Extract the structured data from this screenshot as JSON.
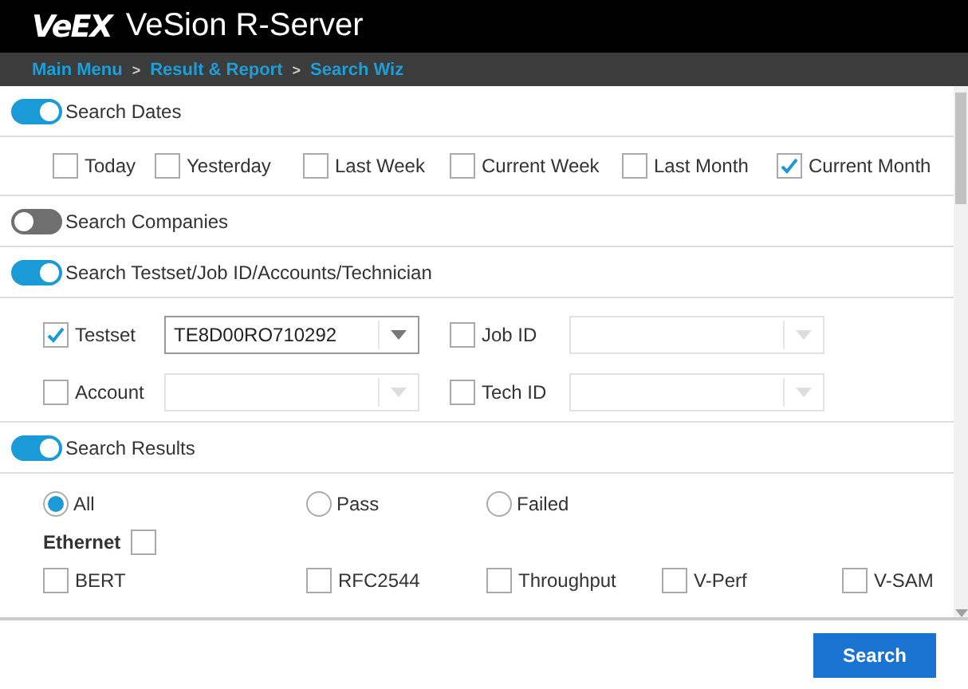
{
  "header": {
    "brand": "VeEX",
    "title": "VeSion R-Server"
  },
  "breadcrumb": [
    {
      "kind": "link",
      "text": "Main Menu"
    },
    {
      "kind": "sep",
      "text": ">"
    },
    {
      "kind": "link",
      "text": "Result & Report"
    },
    {
      "kind": "sep",
      "text": ">"
    },
    {
      "kind": "link",
      "text": "Search Wiz"
    }
  ],
  "sections": [
    {
      "kind": "dates",
      "label": "Search Dates",
      "on": true,
      "options": [
        {
          "label": "Today",
          "checked": false
        },
        {
          "label": "Yesterday",
          "checked": false
        },
        {
          "label": "Last Week",
          "checked": false
        },
        {
          "label": "Current Week",
          "checked": false
        },
        {
          "label": "Last Month",
          "checked": false
        },
        {
          "label": "Current Month",
          "checked": true
        }
      ]
    },
    {
      "kind": "plain",
      "label": "Search Companies",
      "on": false
    },
    {
      "kind": "fields",
      "label": "Search Testset/Job ID/Accounts/Technician",
      "on": true,
      "fields": [
        {
          "label": "Testset",
          "checked": true,
          "value": "TE8D00RO710292",
          "disabled": false
        },
        {
          "label": "Job ID",
          "checked": false,
          "disabled": true
        },
        {
          "label": "Account",
          "checked": false,
          "disabled": true
        },
        {
          "label": "Tech ID",
          "checked": false,
          "disabled": true
        }
      ]
    },
    {
      "kind": "results",
      "label": "Search Results",
      "on": true,
      "outcomes": [
        {
          "label": "All",
          "selected": true
        },
        {
          "label": "Pass",
          "selected": false
        },
        {
          "label": "Failed",
          "selected": false
        }
      ],
      "group": {
        "label": "Ethernet",
        "checked": false
      },
      "tests": [
        {
          "label": "BERT",
          "checked": false
        },
        {
          "label": "RFC2544",
          "checked": false
        },
        {
          "label": "Throughput",
          "checked": false
        },
        {
          "label": "V-Perf",
          "checked": false
        },
        {
          "label": "V-SAM",
          "checked": false
        }
      ]
    }
  ],
  "footer": {
    "button": "Search"
  }
}
